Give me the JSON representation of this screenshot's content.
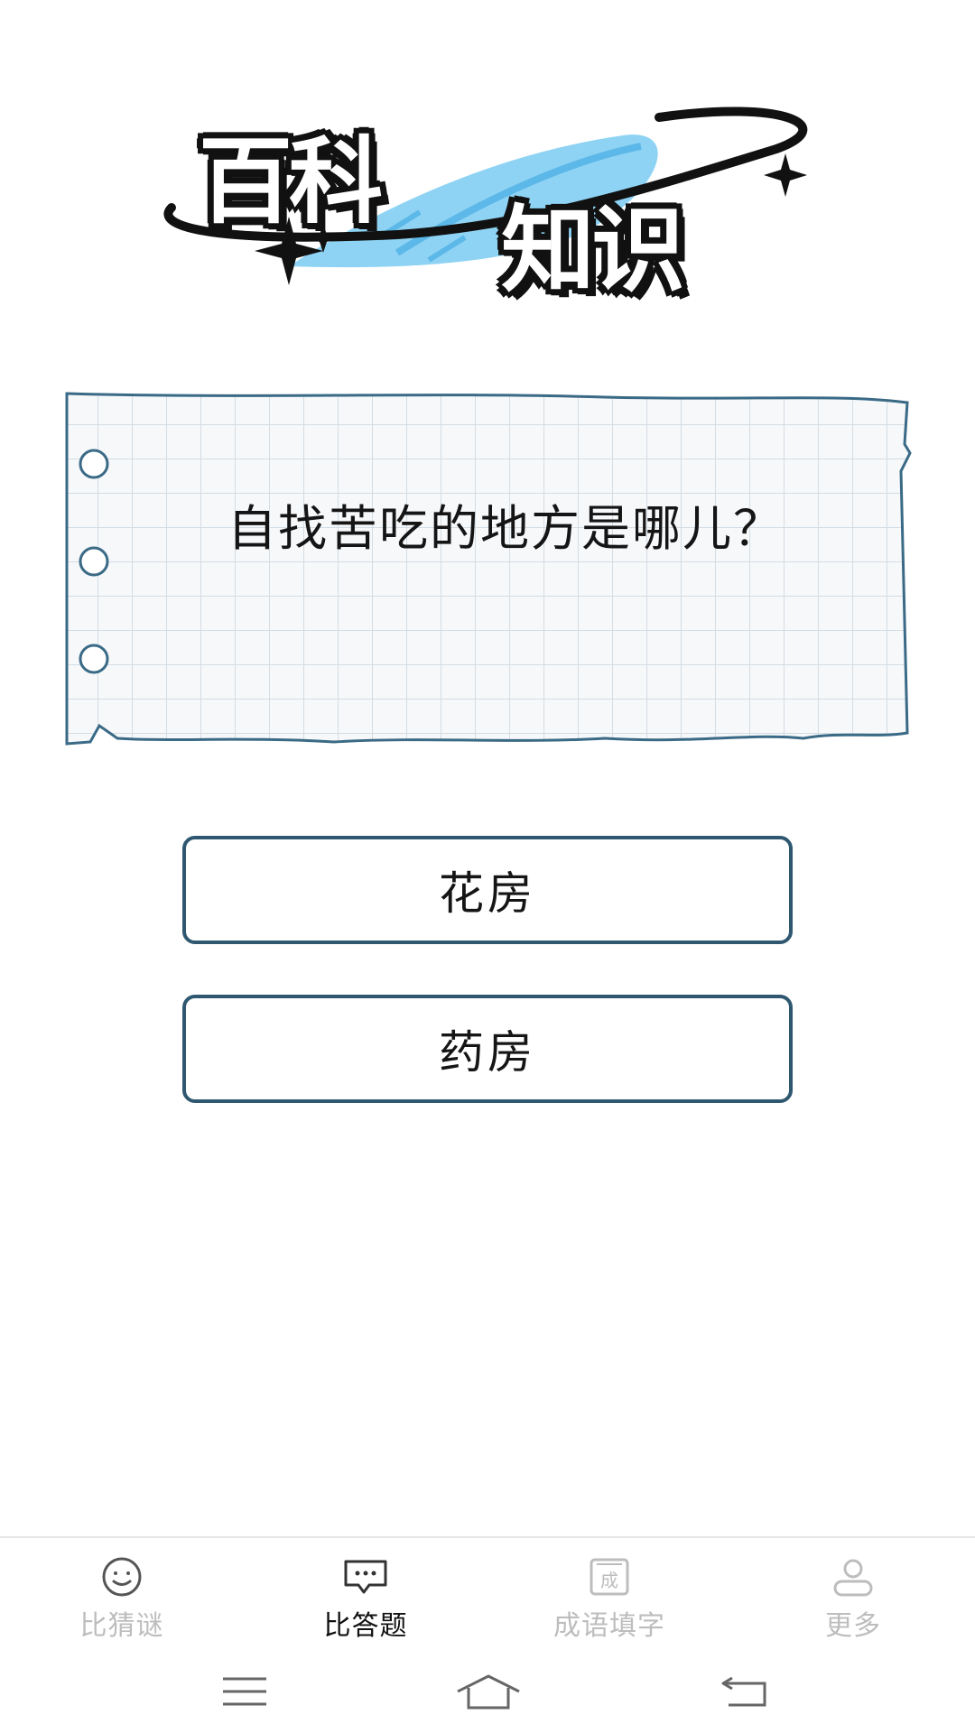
{
  "logo": {
    "word_1": "百科",
    "word_2": "知识",
    "colors": {
      "outline": "#111111",
      "accent": "#8fd3f4",
      "accent_dark": "#5cb8e8"
    }
  },
  "question": {
    "text": "自找苦吃的地方是哪儿？"
  },
  "options": [
    {
      "label": "花房"
    },
    {
      "label": "药房"
    }
  ],
  "tabbar": {
    "items": [
      {
        "label": "比猜谜",
        "icon": "smiley-icon",
        "active": false
      },
      {
        "label": "比答题",
        "icon": "chat-bubble-icon",
        "active": true
      },
      {
        "label": "成语填字",
        "icon": "idiom-card-icon",
        "icon_text": "成",
        "active": false
      },
      {
        "label": "更多",
        "icon": "person-icon",
        "active": false
      }
    ]
  },
  "navbar": {
    "icons": [
      "menu-icon",
      "home-icon",
      "back-icon"
    ]
  },
  "colors": {
    "option_border": "#2f5870",
    "paper_border": "#3a6a86",
    "grid_line": "#d4dde4",
    "tab_inactive": "#bdbdbd",
    "tab_active": "#111111"
  }
}
